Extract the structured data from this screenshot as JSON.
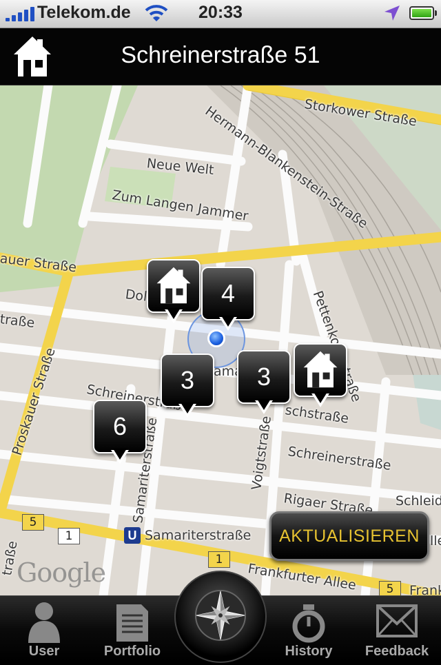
{
  "status_bar": {
    "carrier": "Telekom.de",
    "time": "20:33",
    "accent": "#1f4fc3"
  },
  "navbar": {
    "icon": "house-icon",
    "title": "Schreinerstraße 51"
  },
  "map": {
    "streets": [
      {
        "id": "storkower",
        "label": "Storkower Straße"
      },
      {
        "id": "hermann",
        "label": "Hermann-Blankenstein-Straße"
      },
      {
        "id": "neue_welt",
        "label": "Neue Welt"
      },
      {
        "id": "langen_jammer",
        "label": "Zum Langen Jammer"
      },
      {
        "id": "auer",
        "label": "auer Straße"
      },
      {
        "id": "dolz",
        "label": "Dolz"
      },
      {
        "id": "strasse_left",
        "label": "traße"
      },
      {
        "id": "pettenkofer",
        "label": "Pettenkoferstraße"
      },
      {
        "id": "proskauer",
        "label": "Proskauer Straße"
      },
      {
        "id": "schreiner1",
        "label": "Schreinerstraße"
      },
      {
        "id": "schreiner2",
        "label": "Schreinerstraße"
      },
      {
        "id": "schstrasse",
        "label": "schstraße"
      },
      {
        "id": "voigt",
        "label": "Voigtstraße"
      },
      {
        "id": "samariter_v",
        "label": "Samariterstraße"
      },
      {
        "id": "rigaer",
        "label": "Rigaer Straße"
      },
      {
        "id": "schleid",
        "label": "Schleid"
      },
      {
        "id": "frankfurter",
        "label": "Frankfurter Allee"
      },
      {
        "id": "frank2",
        "label": "Frank"
      },
      {
        "id": "samariter_u",
        "label": "Samariterstraße"
      },
      {
        "id": "strasse_bl",
        "label": "traße"
      },
      {
        "id": "lle",
        "label": "lle"
      },
      {
        "id": "amar",
        "label": "amar"
      }
    ],
    "shields": [
      "5",
      "1",
      "1",
      "5"
    ],
    "ubahn_label": "U",
    "attribution": "Google",
    "markers": [
      {
        "type": "cluster",
        "count": "4"
      },
      {
        "type": "cluster",
        "count": "3"
      },
      {
        "type": "cluster",
        "count": "3"
      },
      {
        "type": "cluster",
        "count": "6"
      },
      {
        "type": "house",
        "icon": "house-icon"
      },
      {
        "type": "house",
        "icon": "house-icon"
      }
    ],
    "refresh_label": "AKTUALISIEREN"
  },
  "tabbar": {
    "tabs": [
      {
        "label": "User",
        "icon": "user-icon"
      },
      {
        "label": "Portfolio",
        "icon": "portfolio-icon"
      },
      {
        "label": "",
        "icon": "compass-icon"
      },
      {
        "label": "History",
        "icon": "stopwatch-icon"
      },
      {
        "label": "Feedback",
        "icon": "envelope-icon"
      }
    ]
  }
}
